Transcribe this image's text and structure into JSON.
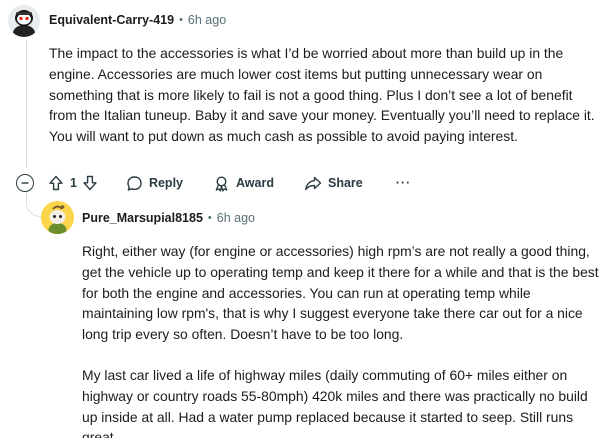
{
  "comment": {
    "author": "Equivalent-Carry-419",
    "separator": "•",
    "time": "6h ago",
    "body": "The impact to the accessories is what I’d be worried about more than build up in the engine. Accessories are much lower cost items but putting unnecessary wear on something that is more likely to fail is not a good thing. Plus I don’t see a lot of benefit from the Italian tuneup. Baby it and save your money. Eventually you’ll need to replace it. You will want to put down as much cash as possible to avoid paying interest.",
    "actions": {
      "vote_count": "1",
      "reply_label": "Reply",
      "award_label": "Award",
      "share_label": "Share",
      "more_label": "···"
    },
    "icons": {
      "collapse": "collapse-minus-icon",
      "upvote": "upvote-arrow-icon",
      "downvote": "downvote-arrow-icon",
      "reply": "speech-bubble-icon",
      "award": "award-ribbon-icon",
      "share": "share-arrow-icon"
    }
  },
  "reply": {
    "author": "Pure_Marsupial8185",
    "separator": "•",
    "time": "6h ago",
    "paragraphs": [
      "Right, either way (for engine or accessories) high rpm’s are not really a good thing, get the vehicle up to operating temp and keep it there for a while and that is the best for both the engine and accessories. You can run at operating temp while maintaining low rpm's, that is why I suggest everyone take there car out for a nice long trip every so often. Doesn’t have to be too long.",
      "My last car lived a life of highway miles (daily commuting of 60+ miles either on highway or country roads 55-80mph) 420k miles and there was practically no build up inside at all. Had a water pump replaced because it started to seep. Still runs great."
    ]
  },
  "colors": {
    "text": "#1c1c1c",
    "meta": "#576f76",
    "action": "#2a3c42",
    "thread_line": "#dcdfe1",
    "reply_avatar_bg": "#fcd64a"
  }
}
